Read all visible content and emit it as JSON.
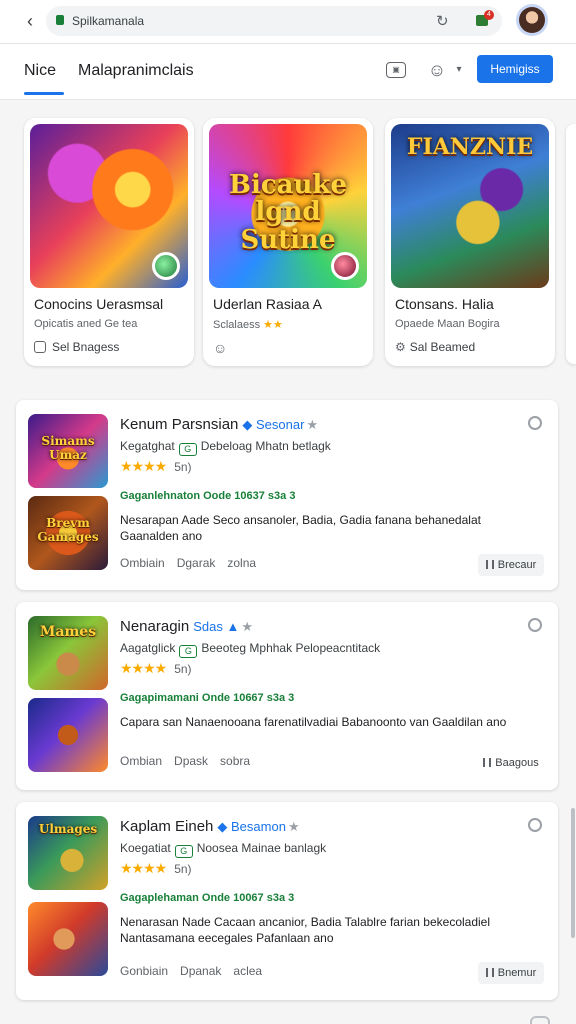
{
  "browser": {
    "url": "Spilkamanala",
    "notification_count": "4"
  },
  "header": {
    "tabs": [
      {
        "label": "Nice"
      },
      {
        "label": "Malapranimclais"
      }
    ],
    "primary_button": "Hemigiss"
  },
  "featured": [
    {
      "art_title": "",
      "name": "Conocins Uerasmsal",
      "sub": "Opicatis aned Ge tea",
      "meta": "Sel Bnagess"
    },
    {
      "art_title": "Bicauke lgnd Sutine",
      "name": "Uderlan Rasiaa A",
      "sub": "Sclalaess",
      "meta": ""
    },
    {
      "art_title": "FIANZNIE",
      "name": "Ctonsans. Halia",
      "sub": "Opaede Maan Bogira",
      "meta": "Sal Beamed"
    }
  ],
  "listings": [
    {
      "title": "Kenum Parsnsian",
      "tag": "Sesonar",
      "sub_left": "Kegatghat",
      "sub_right": "Debeloag Mhatn betlagk",
      "rating_stars": "★★★★",
      "rating_count": "5n)",
      "green": "Gaganlehnaton Oode 10637 s3a 3",
      "desc": "Nesarapan Aade Seco ansanoler, Badia, Gadia fanana behanedalat Gaanalden ano",
      "foot": [
        "Ombiain",
        "Dgarak",
        "zolna"
      ],
      "chip": "Brecaur",
      "thumb_title_a": "Simams Umaz",
      "thumb_title_b": "Brevm Gamages"
    },
    {
      "title": "Nenaragin",
      "tag": "Sdas",
      "sub_left": "Aagatglick",
      "sub_right": "Beeoteg Mphhak Pelopeacntitack",
      "rating_stars": "★★★★",
      "rating_count": "5n)",
      "green": "Gagapimamani Onde 10667 s3a 3",
      "desc": "Capara san Nanaenooana farenatilvadiai Babanoonto van Gaaldilan ano",
      "foot": [
        "Ombian",
        "Dpask",
        "sobra"
      ],
      "chip": "Baagous",
      "thumb_title_a": "Mames",
      "thumb_title_b": ""
    },
    {
      "title": "Kaplam Eineh",
      "tag": "Besamon",
      "sub_left": "Koegatiat",
      "sub_right": "Noosea Mainae banlagk",
      "rating_stars": "★★★★",
      "rating_count": "5n)",
      "green": "Gagaplehaman Onde 10067 s3a 3",
      "desc": "Nenarasan Nade Cacaan ancanior, Badia Talablre farian bekecoladiel Nantasamana eecegales Pafanlaan ano",
      "foot": [
        "Gonbiain",
        "Dpanak",
        "aclea"
      ],
      "chip": "Bnemur",
      "thumb_title_a": "Ulmages",
      "thumb_title_b": ""
    }
  ],
  "colors": {
    "accent": "#1a73e8",
    "green": "#188038",
    "star": "#f9ab00",
    "background": "#f5f5f6"
  },
  "icons": {
    "back": "arrow-left",
    "lock": "lock",
    "reload": "refresh",
    "extension": "shopping-cart",
    "card": "card",
    "face": "smiley",
    "menu": "chevron-down",
    "verified": "verified",
    "radio": "radio-button",
    "chip": "pause-bars"
  }
}
